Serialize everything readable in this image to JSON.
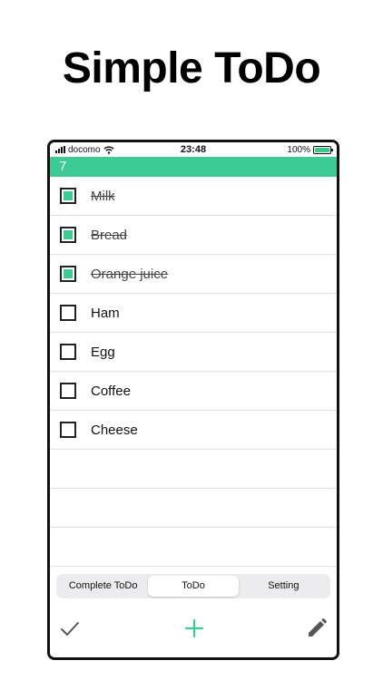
{
  "headline": "Simple ToDo",
  "status_bar": {
    "carrier": "docomo",
    "time": "23:48",
    "battery": "100%"
  },
  "count": "7",
  "todos": [
    {
      "label": "Milk",
      "done": true
    },
    {
      "label": "Bread",
      "done": true
    },
    {
      "label": "Orange juice",
      "done": true
    },
    {
      "label": "Ham",
      "done": false
    },
    {
      "label": "Egg",
      "done": false
    },
    {
      "label": "Coffee",
      "done": false
    },
    {
      "label": "Cheese",
      "done": false
    },
    {
      "label": "",
      "done": null
    },
    {
      "label": "",
      "done": null
    },
    {
      "label": "",
      "done": null
    }
  ],
  "tabs": {
    "complete": "Complete ToDo",
    "todo": "ToDo",
    "setting": "Setting",
    "active": "todo"
  },
  "toolbar": {
    "left_icon": "checkmark-icon",
    "center_icon": "plus-icon",
    "right_icon": "pencil-icon"
  },
  "colors": {
    "accent": "#3ccb93",
    "text": "#111111",
    "divider": "#e2e2e2"
  }
}
